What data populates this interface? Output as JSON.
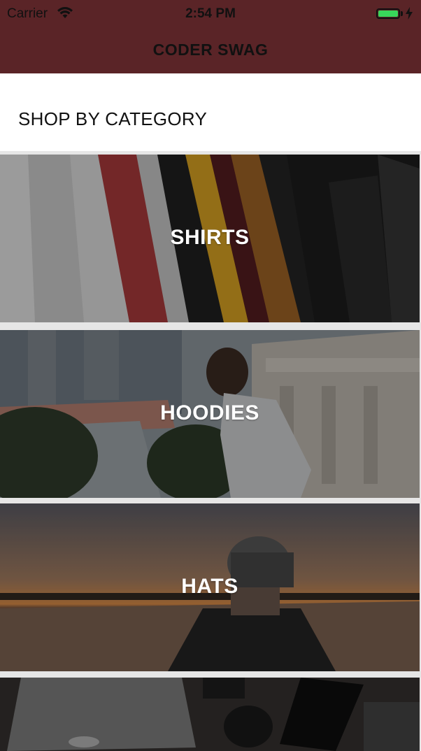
{
  "status_bar": {
    "carrier": "Carrier",
    "time": "2:54 PM",
    "battery_level": 1.0
  },
  "nav": {
    "title": "CODER SWAG",
    "background_color": "#5a2427"
  },
  "section": {
    "title": "SHOP BY CATEGORY"
  },
  "categories": [
    {
      "label": "SHIRTS",
      "image": "shirts-on-rack"
    },
    {
      "label": "HOODIES",
      "image": "man-in-hoodie"
    },
    {
      "label": "HATS",
      "image": "man-in-cap-at-sunset"
    },
    {
      "label": "",
      "image": "desk-with-laptop-and-camera"
    }
  ],
  "icons": {
    "wifi": "wifi-icon",
    "battery": "battery-icon",
    "charging": "charging-bolt-icon"
  }
}
